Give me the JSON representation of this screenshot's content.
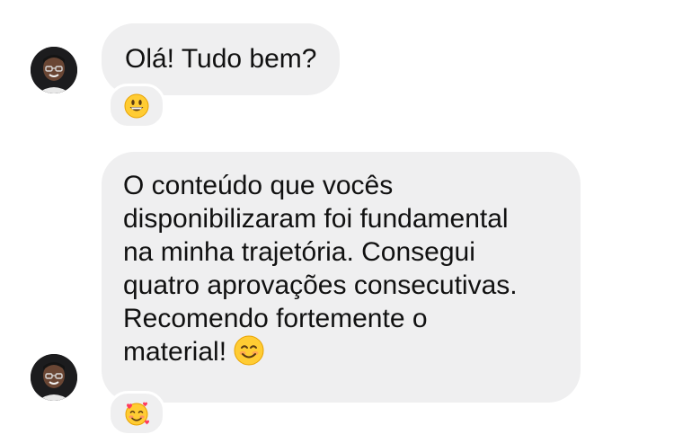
{
  "messages": [
    {
      "text_lines": [
        "Olá! Tudo bem?"
      ],
      "reaction": "grinning-face-emoji"
    },
    {
      "text_lines": [
        "O conteúdo que vocês",
        "disponibilizaram foi fundamental",
        "na minha trajetória. Consegui",
        "quatro aprovações consecutivas.",
        "Recomendo fortemente o",
        "material!"
      ],
      "inline_emoji": "smiling-face-emoji",
      "reaction": "smiling-face-with-hearts-emoji"
    }
  ],
  "colors": {
    "bubble_background": "#efeff0",
    "text": "#111111",
    "avatar": "#1c1c1e"
  }
}
